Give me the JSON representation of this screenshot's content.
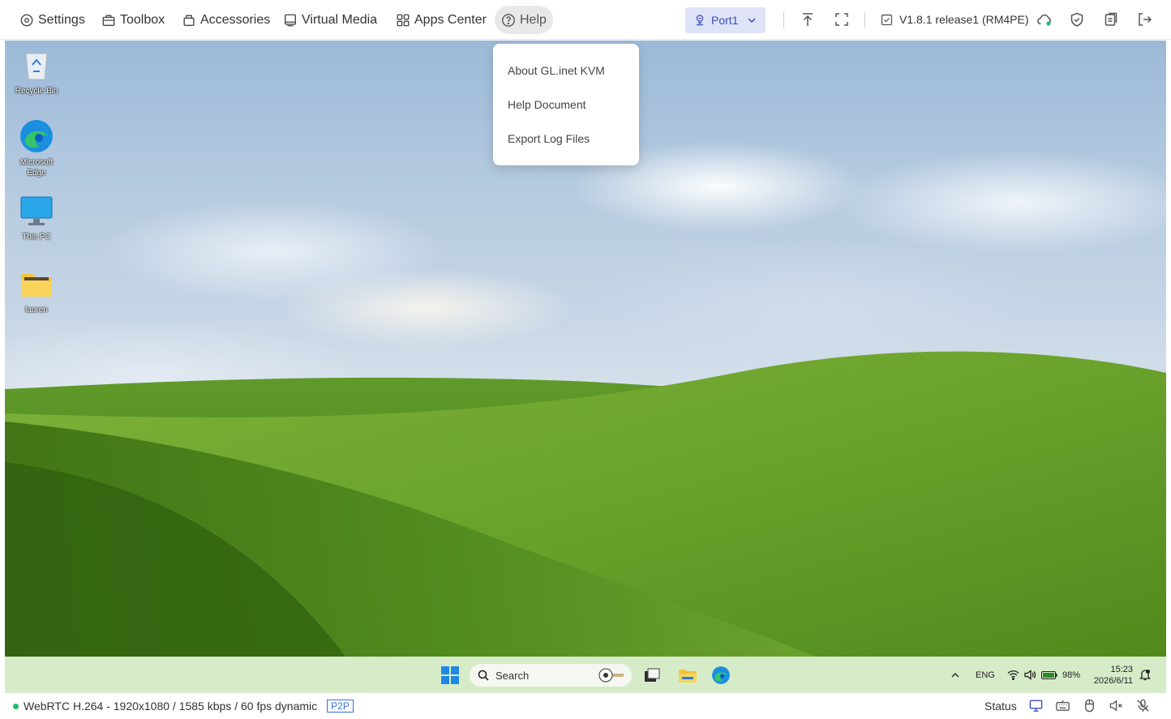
{
  "toolbar": {
    "settings": "Settings",
    "toolbox": "Toolbox",
    "accessories": "Accessories",
    "virtual_media": "Virtual Media",
    "apps_center": "Apps Center",
    "help": "Help",
    "port": "Port1",
    "version": "V1.8.1 release1 (RM4PE)"
  },
  "help_menu": {
    "items": [
      "About GL.inet KVM",
      "Help Document",
      "Export Log Files"
    ]
  },
  "desktop": {
    "icons": [
      "Recycle Bin",
      "Microsoft Edge",
      "This PC",
      "lauren"
    ]
  },
  "taskbar": {
    "search_placeholder": "Search",
    "language": "ENG",
    "battery": "98%",
    "time": "15:23",
    "date": "2026/6/11"
  },
  "statusbar": {
    "stream_info": "WebRTC H.264 - 1920x1080 / 1585 kbps / 60 fps dynamic",
    "mode": "P2P",
    "status_label": "Status"
  },
  "colors": {
    "accent": "#3b4bbd",
    "connected": "#1fbf6e",
    "taskbar": "#d6ecc9"
  }
}
